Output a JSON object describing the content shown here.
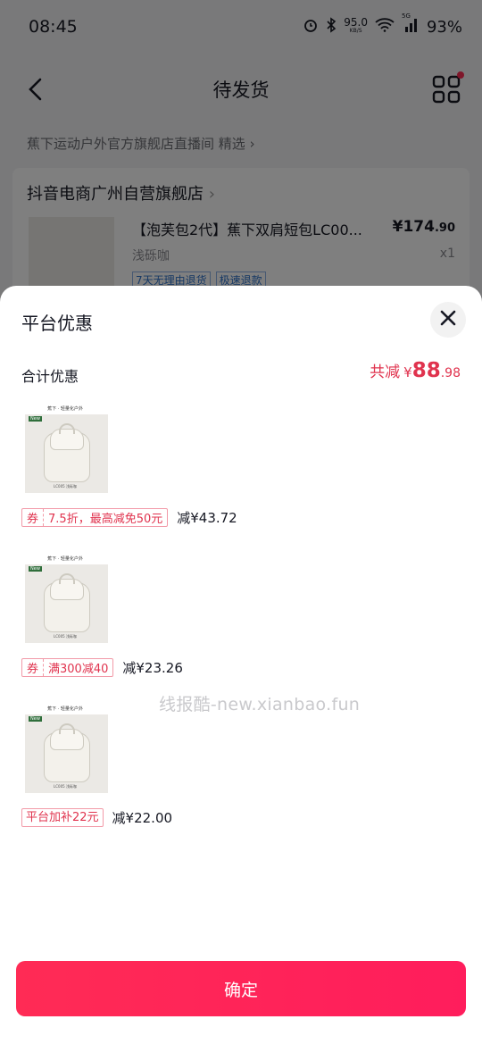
{
  "status_bar": {
    "time": "08:45",
    "net_speed": "95.0",
    "net_unit": "KB/S",
    "signal_label": "5G",
    "battery": "93%"
  },
  "nav": {
    "title": "待发货"
  },
  "order": {
    "live_source": "蕉下运动户外官方旗舰店直播间 精选",
    "shop_name": "抖音电商广州自营旗舰店",
    "product_title": "【泡芙包2代】蕉下双肩短包LC00...",
    "price_main": "¥174",
    "price_decimal": ".90",
    "spec": "浅砾咖",
    "quantity": "x1",
    "tags": [
      "7天无理由退货",
      "极速退款"
    ]
  },
  "sheet": {
    "title": "平台优惠",
    "total_label": "合计优惠",
    "total_prefix": "共减",
    "total_yen": "¥",
    "total_integer": "88",
    "total_decimal": ".98",
    "items": [
      {
        "brand_text": "蕉下 · 轻量化户外",
        "new_label": "New",
        "caption": "LC005 浅砾咖",
        "coupon_kind": "券",
        "coupon_text": "7.5折，最高减免50元",
        "amount": "减¥43.72"
      },
      {
        "brand_text": "蕉下 · 轻量化户外",
        "new_label": "New",
        "caption": "LC005 浅砾咖",
        "coupon_kind": "券",
        "coupon_text": "满300减40",
        "amount": "减¥23.26"
      },
      {
        "brand_text": "蕉下 · 轻量化户外",
        "new_label": "New",
        "caption": "LC005 浅砾咖",
        "platform_text": "平台加补22元",
        "amount": "减¥22.00"
      }
    ],
    "watermark": "线报酷-new.xianbao.fun",
    "confirm_label": "确定"
  },
  "colors": {
    "accent": "#fe2c55",
    "discount_red": "#e0334e",
    "tag_blue": "#2c71c8"
  },
  "icons": [
    "back-arrow-icon",
    "grid-menu-icon",
    "chevron-right-icon",
    "close-icon",
    "alarm-icon",
    "bluetooth-icon",
    "wifi-icon",
    "signal-icon"
  ]
}
